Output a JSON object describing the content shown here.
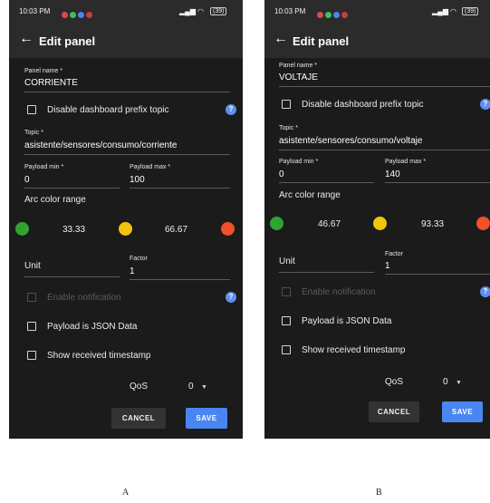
{
  "panel_a": {
    "status": {
      "time": "10:03 PM",
      "battery": "(39)"
    },
    "header": {
      "title": "Edit panel"
    },
    "panel_name": {
      "label": "Panel name *",
      "value": "CORRIENTE"
    },
    "disable_prefix": {
      "label": "Disable dashboard prefix topic",
      "checked": false
    },
    "topic": {
      "label": "Topic *",
      "value": "asistente/sensores/consumo/corriente"
    },
    "payload_min": {
      "label": "Payload min *",
      "value": "0"
    },
    "payload_max": {
      "label": "Payload max *",
      "value": "100"
    },
    "arc": {
      "label": "Arc color range",
      "low": "33.33",
      "high": "66.67",
      "colors": {
        "low": "#2fa52f",
        "mid": "#f2c40d",
        "high": "#f0502a"
      }
    },
    "unit": {
      "label": "Unit",
      "value": ""
    },
    "factor": {
      "label": "Factor",
      "value": "1"
    },
    "enable_notification": {
      "label": "Enable notification",
      "disabled": true
    },
    "payload_json": {
      "label": "Payload is JSON Data",
      "checked": false
    },
    "show_timestamp": {
      "label": "Show received timestamp",
      "checked": false
    },
    "qos": {
      "label": "QoS",
      "value": "0"
    },
    "actions": {
      "cancel": "CANCEL",
      "save": "SAVE"
    }
  },
  "panel_b": {
    "status": {
      "time": "10:03 PM",
      "battery": "(39)"
    },
    "header": {
      "title": "Edit panel"
    },
    "panel_name": {
      "label": "Panel name *",
      "value": "VOLTAJE"
    },
    "disable_prefix": {
      "label": "Disable dashboard prefix topic",
      "checked": false
    },
    "topic": {
      "label": "Topic *",
      "value": "asistente/sensores/consumo/voltaje"
    },
    "payload_min": {
      "label": "Payload min *",
      "value": "0"
    },
    "payload_max": {
      "label": "Payload max *",
      "value": "140"
    },
    "arc": {
      "label": "Arc color range",
      "low": "46.67",
      "high": "93.33",
      "colors": {
        "low": "#2fa52f",
        "mid": "#f2c40d",
        "high": "#f0502a"
      }
    },
    "unit": {
      "label": "Unit",
      "value": ""
    },
    "factor": {
      "label": "Factor",
      "value": "1"
    },
    "enable_notification": {
      "label": "Enable notification",
      "disabled": true
    },
    "payload_json": {
      "label": "Payload is JSON Data",
      "checked": false
    },
    "show_timestamp": {
      "label": "Show received timestamp",
      "checked": false
    },
    "qos": {
      "label": "QoS",
      "value": "0"
    },
    "actions": {
      "cancel": "CANCEL",
      "save": "SAVE"
    }
  },
  "captions": {
    "a": "A",
    "b": "B"
  },
  "icons": {
    "back": "back-arrow-icon",
    "help": "help-icon",
    "dropdown": "dropdown-arrow-icon",
    "wifi": "wifi-icon",
    "signal": "signal-icon",
    "battery": "battery-icon"
  }
}
